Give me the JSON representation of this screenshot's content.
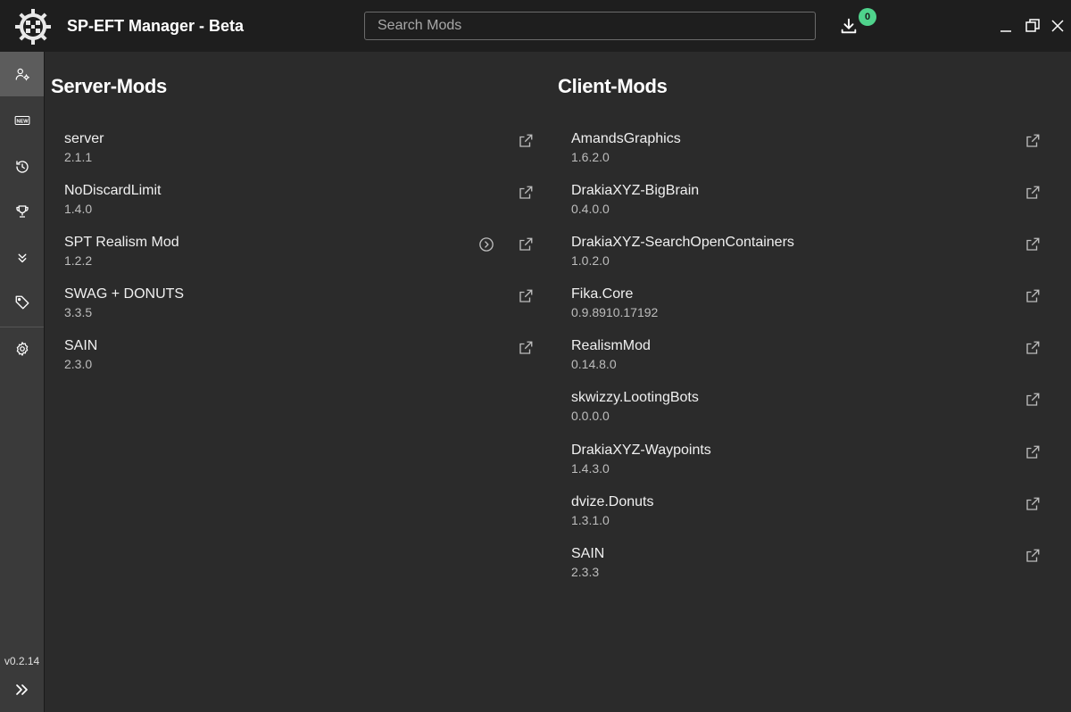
{
  "app": {
    "title": "SP-EFT Manager - Beta",
    "search_placeholder": "Search Mods",
    "download_count": "0",
    "version": "v0.2.14",
    "accent_badge_color": "#4fd38c"
  },
  "sidebar": {
    "items": [
      {
        "icon": "user-settings-icon",
        "active": true
      },
      {
        "icon": "new-icon",
        "active": false
      },
      {
        "icon": "history-icon",
        "active": false
      },
      {
        "icon": "trophy-icon",
        "active": false
      },
      {
        "icon": "chevrons-down-icon",
        "active": false
      },
      {
        "icon": "tag-icon",
        "active": false
      },
      {
        "icon": "gear-icon",
        "active": false
      }
    ]
  },
  "server": {
    "title": "Server-Mods",
    "mods": [
      {
        "name": "server",
        "version": "2.1.1"
      },
      {
        "name": "NoDiscardLimit",
        "version": "1.4.0"
      },
      {
        "name": "SPT Realism Mod",
        "version": "1.2.2"
      },
      {
        "name": "SWAG + DONUTS",
        "version": "3.3.5"
      },
      {
        "name": "SAIN",
        "version": "2.3.0"
      }
    ]
  },
  "client": {
    "title": "Client-Mods",
    "mods": [
      {
        "name": "AmandsGraphics",
        "version": "1.6.2.0"
      },
      {
        "name": "DrakiaXYZ-BigBrain",
        "version": "0.4.0.0"
      },
      {
        "name": "DrakiaXYZ-SearchOpenContainers",
        "version": "1.0.2.0"
      },
      {
        "name": "Fika.Core",
        "version": "0.9.8910.17192"
      },
      {
        "name": "RealismMod",
        "version": "0.14.8.0"
      },
      {
        "name": "skwizzy.LootingBots",
        "version": "0.0.0.0"
      },
      {
        "name": "DrakiaXYZ-Waypoints",
        "version": "1.4.3.0"
      },
      {
        "name": "dvize.Donuts",
        "version": "1.3.1.0"
      },
      {
        "name": "SAIN",
        "version": "2.3.3"
      }
    ]
  }
}
